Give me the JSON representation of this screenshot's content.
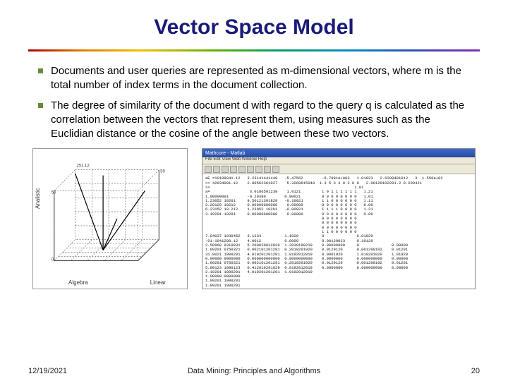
{
  "title": "Vector Space Model",
  "bullets": [
    "Documents and user queries are represented as m-dimensional vectors, where m is the total number of index terms in the document collection.",
    "The degree of similarity of the document d with regard to the query q is calculated as the correlation between the vectors that represent them, using measures such as the Euclidian distance or the cosine of the angle between these two vectors."
  ],
  "fig_left": {
    "y_label": "Analistic",
    "x_label_a": "Algebra",
    "x_label_b": "Linear",
    "corner_label": "251.12"
  },
  "fig_right": {
    "window_title": "Mathcore - Matlab",
    "menu": "File  Edit  View  Web  Window  Help",
    "matrix_rows": [
      "aE =10109041.12   3.23141441449   -5.47562        -6.7991e+003   1.01923   2.6209481012   3  1.550e+02",
      ">> 42934091.12    2.80562361027    5.3268615048  1.3 5 3 3 9 2 0 0   2.09120102201.2 0.209421",
      ">>                                                              1.01",
      "a=                 3.0186591239    1.0121         1 0 1 1 1 1 1 1   1.21",
      "1.00000001        -0.20380        0.90021         0 0 0 0 0 0 0 0   1.01",
      "1.23052 10201     9.50121391829   -0.10021        1 1 0 0 0 0 0 0   1.11",
      "2.20129 10212     0.00000000000    0.00000        0 0 0 0 0 0 0 0   0.00",
      "6.23152 10.212    1.23052 10201   -0.00021        1 1 1 1 0 0 0 0   1.21",
      "3.19201 10201     0.00000000000    0.00000        0 0 0 0 0 0 0 0   0.00",
      "                                                  0 0 0 0 0 0 0 0",
      "                                                  0 0 0 0 0 0 0 0",
      "                                                  0 0 0 0 0 0 0 0",
      "                                                  1 1 0 0 0 0 0 0",
      "7.04037 1030452   3.1234          1.1020          0              0.01920",
      "-01-1041200.12    4.0012          0.0000          0.00129023     0.10120",
      "2.50968 9310831   5.200920012920  1.2039190219    0.00000000     0              0.00000",
      "1.09201 0750321   0.002101201291  0.2019201920    0.0129120      0.001200102    0.01201",
      "31.9021 1000201   4.019201201201  1.0192012019    0.0001920      1.019201020    1.01920",
      "0.00000 0000000   0.000000000000  0.0000000000    0.0000000      0.000000000    0.00000",
      "1.09201 0750321   0.002101201291  0.2019201920    0.0129120      0.001200102    0.01201",
      "5.09123 1000123   0.412010291029  0.0192012019    0.0000000      0.000000000    0.00000",
      "2.19201 1000201   4.019201201201  1.0192012019                                        ",
      "1.00000 0000000                                                                       ",
      "1.09201 1000201                                                                       ",
      "1.09201 1000201                                                                       ",
      ">>"
    ]
  },
  "footer": {
    "left": "12/19/2021",
    "center": "Data Mining: Principles and Algorithms",
    "right": "20"
  }
}
